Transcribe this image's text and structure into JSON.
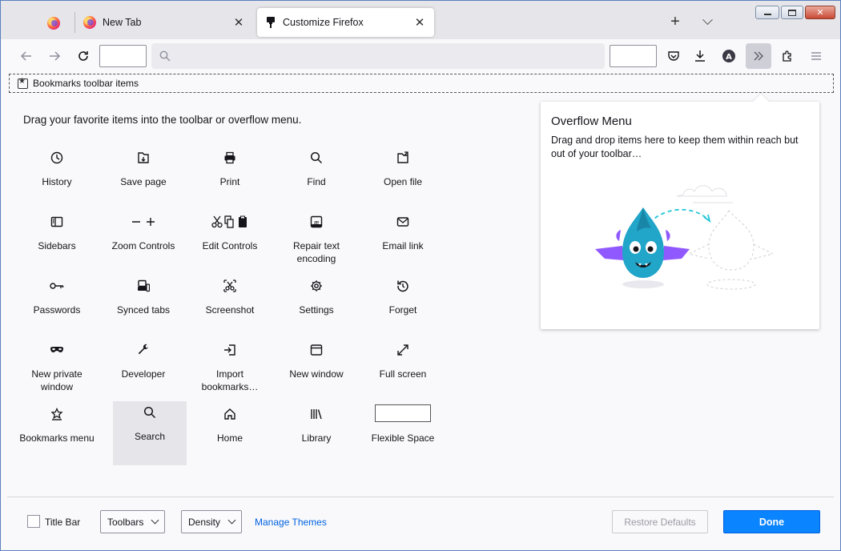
{
  "tabs": {
    "pinned": {
      "icon": "firefox-icon"
    },
    "items": [
      {
        "label": "New Tab",
        "icon": "firefox-icon",
        "close": "✕"
      },
      {
        "label": "Customize Firefox",
        "icon": "customize-brush-icon",
        "close": "✕"
      }
    ],
    "new_tab": "+"
  },
  "navbar": {
    "back_icon": "back-arrow-icon",
    "forward_icon": "forward-arrow-icon",
    "reload_icon": "reload-icon",
    "overflow_label": "»"
  },
  "bookmarks_toolbar": {
    "label": "Bookmarks toolbar items"
  },
  "palette": {
    "title": "Drag your favorite items into the toolbar or overflow menu.",
    "items": [
      {
        "label": "History",
        "icon": "history-icon"
      },
      {
        "label": "Save page",
        "icon": "save-page-icon"
      },
      {
        "label": "Print",
        "icon": "print-icon"
      },
      {
        "label": "Find",
        "icon": "find-icon"
      },
      {
        "label": "Open file",
        "icon": "open-file-icon"
      },
      {
        "label": "Sidebars",
        "icon": "sidebars-icon"
      },
      {
        "label": "Zoom Controls",
        "icon": "zoom-controls-icon"
      },
      {
        "label": "Edit Controls",
        "icon": "edit-controls-icon"
      },
      {
        "label": "Repair text encoding",
        "icon": "text-encoding-icon"
      },
      {
        "label": "Email link",
        "icon": "email-icon"
      },
      {
        "label": "Passwords",
        "icon": "key-icon"
      },
      {
        "label": "Synced tabs",
        "icon": "synced-tabs-icon"
      },
      {
        "label": "Screenshot",
        "icon": "screenshot-icon"
      },
      {
        "label": "Settings",
        "icon": "gear-icon"
      },
      {
        "label": "Forget",
        "icon": "forget-icon"
      },
      {
        "label": "New private window",
        "icon": "private-mask-icon"
      },
      {
        "label": "Developer",
        "icon": "wrench-icon"
      },
      {
        "label": "Import bookmarks…",
        "icon": "import-icon"
      },
      {
        "label": "New window",
        "icon": "new-window-icon"
      },
      {
        "label": "Full screen",
        "icon": "fullscreen-icon"
      },
      {
        "label": "Bookmarks menu",
        "icon": "bookmarks-menu-icon"
      },
      {
        "label": "Search",
        "icon": "search-icon"
      },
      {
        "label": "Home",
        "icon": "home-icon"
      },
      {
        "label": "Library",
        "icon": "library-icon"
      },
      {
        "label": "Flexible Space",
        "icon": "flexible-space"
      }
    ]
  },
  "overflow_menu": {
    "title": "Overflow Menu",
    "description": "Drag and drop items here to keep them within reach but out of your toolbar…"
  },
  "footer": {
    "title_bar_label": "Title Bar",
    "toolbars_label": "Toolbars",
    "density_label": "Density",
    "manage_themes": "Manage Themes",
    "restore_defaults": "Restore Defaults",
    "done": "Done"
  },
  "colors": {
    "accent": "#0a84ff",
    "link": "#0061e0",
    "mascot": "#21a5c9",
    "mascot_wings": "#9059ff"
  }
}
